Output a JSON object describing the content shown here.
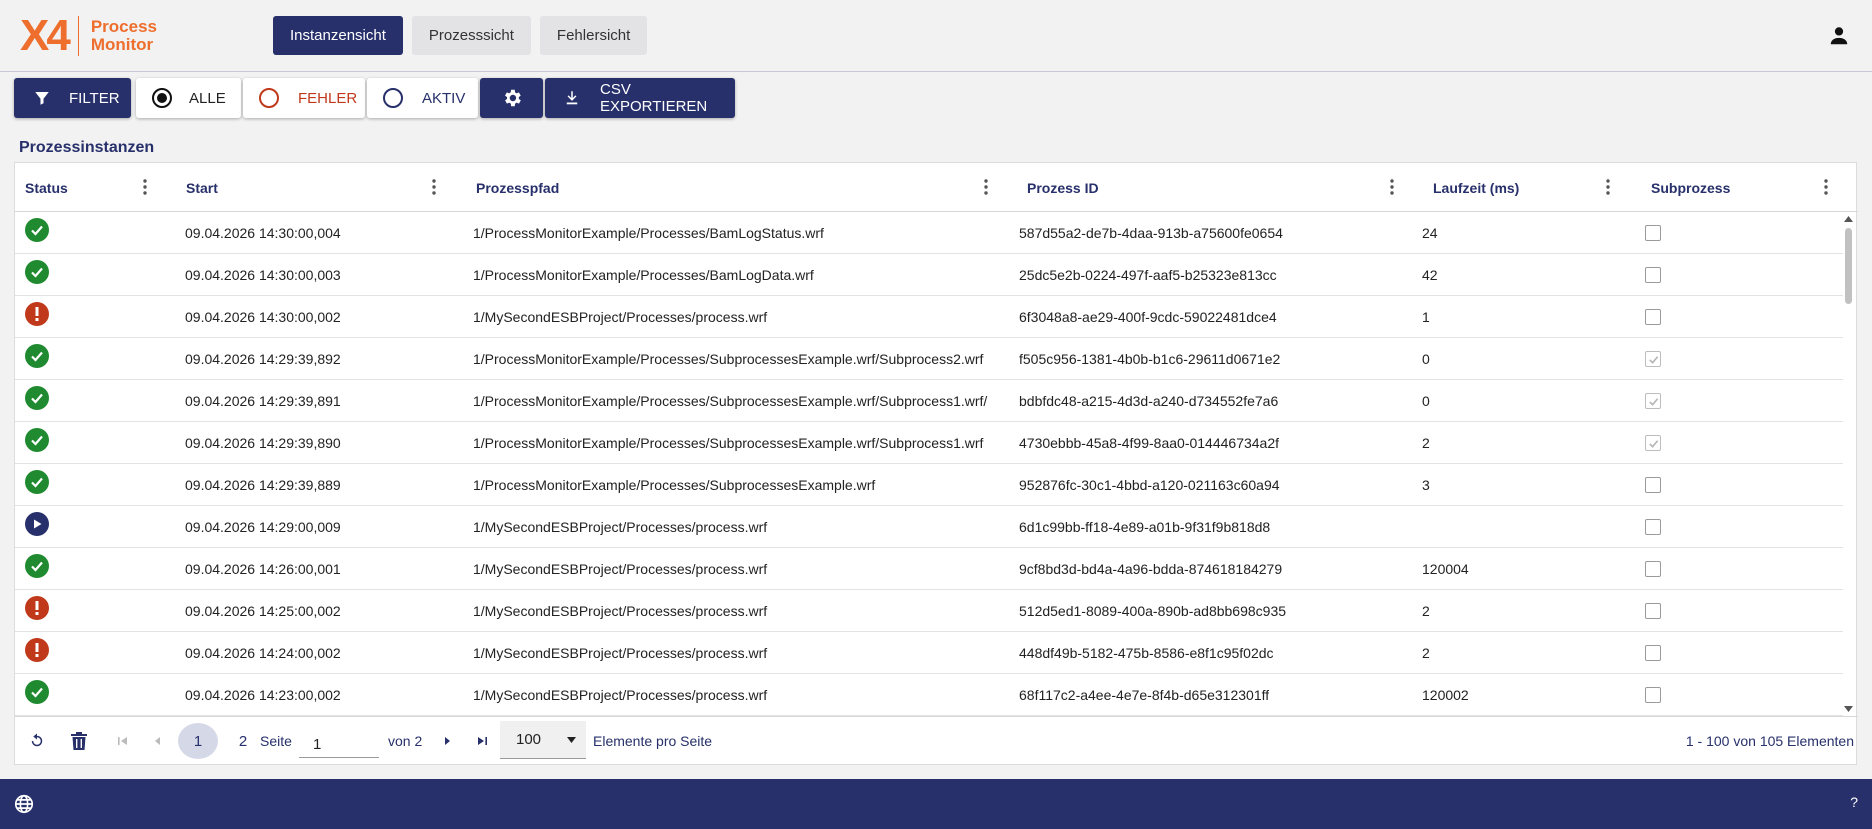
{
  "app": {
    "logo_mark": "X4",
    "logo_line1": "Process",
    "logo_line2": "Monitor",
    "brand_color": "#ee6f2d",
    "accent_color": "#27306b"
  },
  "nav": {
    "tabs": [
      {
        "label": "Instanzensicht",
        "active": true
      },
      {
        "label": "Prozesssicht",
        "active": false
      },
      {
        "label": "Fehlersicht",
        "active": false
      }
    ],
    "user_icon": "person-icon"
  },
  "toolbar": {
    "filter_label": "FILTER",
    "radio_all": "ALLE",
    "radio_error": "FEHLER",
    "radio_active": "AKTIV",
    "selected_radio": "ALLE",
    "settings_icon": "gear-icon",
    "export_label": "CSV EXPORTIEREN"
  },
  "section_title": "Prozessinstanzen",
  "table": {
    "columns": {
      "status": "Status",
      "start": "Start",
      "path": "Prozesspfad",
      "id": "Prozess ID",
      "runtime": "Laufzeit (ms)",
      "sub": "Subprozess"
    },
    "rows": [
      {
        "status": "success",
        "start": "09.04.2026 14:30:00,004",
        "path": "1/ProcessMonitorExample/Processes/BamLogStatus.wrf",
        "id": "587d55a2-de7b-4daa-913b-a75600fe0654",
        "runtime": "24",
        "sub": false
      },
      {
        "status": "success",
        "start": "09.04.2026 14:30:00,003",
        "path": "1/ProcessMonitorExample/Processes/BamLogData.wrf",
        "id": "25dc5e2b-0224-497f-aaf5-b25323e813cc",
        "runtime": "42",
        "sub": false
      },
      {
        "status": "error",
        "start": "09.04.2026 14:30:00,002",
        "path": "1/MySecondESBProject/Processes/process.wrf",
        "id": "6f3048a8-ae29-400f-9cdc-59022481dce4",
        "runtime": "1",
        "sub": false
      },
      {
        "status": "success",
        "start": "09.04.2026 14:29:39,892",
        "path": "1/ProcessMonitorExample/Processes/SubprocessesExample.wrf/Subprocess2.wrf",
        "id": "f505c956-1381-4b0b-b1c6-29611d0671e2",
        "runtime": "0",
        "sub": true
      },
      {
        "status": "success",
        "start": "09.04.2026 14:29:39,891",
        "path": "1/ProcessMonitorExample/Processes/SubprocessesExample.wrf/Subprocess1.wrf/",
        "id": "bdbfdc48-a215-4d3d-a240-d734552fe7a6",
        "runtime": "0",
        "sub": true
      },
      {
        "status": "success",
        "start": "09.04.2026 14:29:39,890",
        "path": "1/ProcessMonitorExample/Processes/SubprocessesExample.wrf/Subprocess1.wrf",
        "id": "4730ebbb-45a8-4f99-8aa0-014446734a2f",
        "runtime": "2",
        "sub": true
      },
      {
        "status": "success",
        "start": "09.04.2026 14:29:39,889",
        "path": "1/ProcessMonitorExample/Processes/SubprocessesExample.wrf",
        "id": "952876fc-30c1-4bbd-a120-021163c60a94",
        "runtime": "3",
        "sub": false
      },
      {
        "status": "running",
        "start": "09.04.2026 14:29:00,009",
        "path": "1/MySecondESBProject/Processes/process.wrf",
        "id": "6d1c99bb-ff18-4e89-a01b-9f31f9b818d8",
        "runtime": "",
        "sub": false
      },
      {
        "status": "success",
        "start": "09.04.2026 14:26:00,001",
        "path": "1/MySecondESBProject/Processes/process.wrf",
        "id": "9cf8bd3d-bd4a-4a96-bdda-874618184279",
        "runtime": "120004",
        "sub": false
      },
      {
        "status": "error",
        "start": "09.04.2026 14:25:00,002",
        "path": "1/MySecondESBProject/Processes/process.wrf",
        "id": "512d5ed1-8089-400a-890b-ad8bb698c935",
        "runtime": "2",
        "sub": false
      },
      {
        "status": "error",
        "start": "09.04.2026 14:24:00,002",
        "path": "1/MySecondESBProject/Processes/process.wrf",
        "id": "448df49b-5182-475b-8586-e8f1c95f02dc",
        "runtime": "2",
        "sub": false
      },
      {
        "status": "success",
        "start": "09.04.2026 14:23:00,002",
        "path": "1/MySecondESBProject/Processes/process.wrf",
        "id": "68f117c2-a4ee-4e7e-8f4b-d65e312301ff",
        "runtime": "120002",
        "sub": false
      }
    ]
  },
  "paginator": {
    "pages": [
      "1",
      "2"
    ],
    "current_page": "1",
    "page_label": "Seite",
    "page_input_value": "1",
    "of_label": "von 2",
    "page_size": "100",
    "page_size_label": "Elemente pro Seite",
    "range_label": "1 - 100 von 105 Elementen"
  },
  "footer": {
    "help_label": "?",
    "globe_icon": "globe-icon"
  },
  "status_colors": {
    "success": "#1f8a2f",
    "error": "#c0391b",
    "running": "#27306b"
  }
}
